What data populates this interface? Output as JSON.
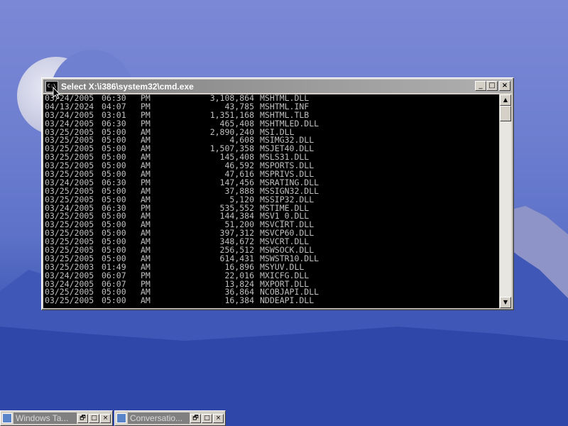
{
  "console_window": {
    "title": "Select X:\\i386\\system32\\cmd.exe",
    "icon": "C:\\",
    "buttons": {
      "minimize": "_",
      "maximize": "□",
      "close": "×"
    },
    "listing": [
      {
        "date": "03/24/2005",
        "time": "06:30",
        "ampm": "PM",
        "size": "3,108,864",
        "name": "MSHTML.DLL"
      },
      {
        "date": "04/13/2024",
        "time": "04:07",
        "ampm": "PM",
        "size": "43,785",
        "name": "MSHTML.INF"
      },
      {
        "date": "03/24/2005",
        "time": "03:01",
        "ampm": "PM",
        "size": "1,351,168",
        "name": "MSHTML.TLB"
      },
      {
        "date": "03/24/2005",
        "time": "06:30",
        "ampm": "PM",
        "size": "465,408",
        "name": "MSHTMLED.DLL"
      },
      {
        "date": "03/25/2005",
        "time": "05:00",
        "ampm": "AM",
        "size": "2,890,240",
        "name": "MSI.DLL"
      },
      {
        "date": "03/25/2005",
        "time": "05:00",
        "ampm": "AM",
        "size": "4,608",
        "name": "MSIMG32.DLL"
      },
      {
        "date": "03/25/2005",
        "time": "05:00",
        "ampm": "AM",
        "size": "1,507,358",
        "name": "MSJET40.DLL"
      },
      {
        "date": "03/25/2005",
        "time": "05:00",
        "ampm": "AM",
        "size": "145,408",
        "name": "MSLS31.DLL"
      },
      {
        "date": "03/25/2005",
        "time": "05:00",
        "ampm": "AM",
        "size": "46,592",
        "name": "MSPORTS.DLL"
      },
      {
        "date": "03/25/2005",
        "time": "05:00",
        "ampm": "AM",
        "size": "47,616",
        "name": "MSPRIVS.DLL"
      },
      {
        "date": "03/24/2005",
        "time": "06:30",
        "ampm": "PM",
        "size": "147,456",
        "name": "MSRATING.DLL"
      },
      {
        "date": "03/25/2005",
        "time": "05:00",
        "ampm": "AM",
        "size": "37,888",
        "name": "MSSIGN32.DLL"
      },
      {
        "date": "03/25/2005",
        "time": "05:00",
        "ampm": "AM",
        "size": "5,120",
        "name": "MSSIP32.DLL"
      },
      {
        "date": "03/24/2005",
        "time": "06:30",
        "ampm": "PM",
        "size": "535,552",
        "name": "MSTIME.DLL"
      },
      {
        "date": "03/25/2005",
        "time": "05:00",
        "ampm": "AM",
        "size": "144,384",
        "name": "MSV1_0.DLL"
      },
      {
        "date": "03/25/2005",
        "time": "05:00",
        "ampm": "AM",
        "size": "51,200",
        "name": "MSVCIRT.DLL"
      },
      {
        "date": "03/25/2005",
        "time": "05:00",
        "ampm": "AM",
        "size": "397,312",
        "name": "MSVCP60.DLL"
      },
      {
        "date": "03/25/2005",
        "time": "05:00",
        "ampm": "AM",
        "size": "348,672",
        "name": "MSVCRT.DLL"
      },
      {
        "date": "03/25/2005",
        "time": "05:00",
        "ampm": "AM",
        "size": "256,512",
        "name": "MSWSOCK.DLL"
      },
      {
        "date": "03/25/2005",
        "time": "05:00",
        "ampm": "AM",
        "size": "614,431",
        "name": "MSWSTR10.DLL"
      },
      {
        "date": "03/25/2003",
        "time": "01:49",
        "ampm": "AM",
        "size": "16,896",
        "name": "MSYUV.DLL"
      },
      {
        "date": "03/24/2005",
        "time": "06:07",
        "ampm": "PM",
        "size": "22,016",
        "name": "MXICFG.DLL"
      },
      {
        "date": "03/24/2005",
        "time": "06:07",
        "ampm": "PM",
        "size": "13,824",
        "name": "MXPORT.DLL"
      },
      {
        "date": "03/25/2005",
        "time": "05:00",
        "ampm": "AM",
        "size": "36,864",
        "name": "NCOBJAPI.DLL"
      },
      {
        "date": "03/25/2005",
        "time": "05:00",
        "ampm": "AM",
        "size": "16,384",
        "name": "NDDEAPI.DLL"
      }
    ],
    "scrollbar": {
      "up_arrow": "▲",
      "down_arrow": "▼"
    }
  },
  "taskbar": [
    {
      "title": "Windows Ta...",
      "buttons": [
        "🗗",
        "□",
        "×"
      ]
    },
    {
      "title": "Conversatio...",
      "buttons": [
        "🗗",
        "□",
        "×"
      ]
    }
  ],
  "colors": {
    "console_bg": "#000000",
    "console_text": "#c0c0c0",
    "titlebar_inactive": "#808080"
  }
}
